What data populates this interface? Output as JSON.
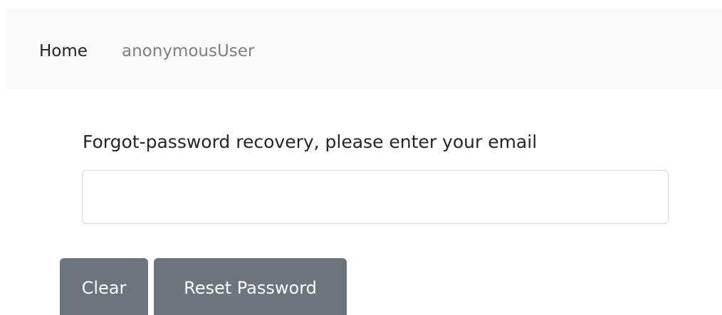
{
  "navbar": {
    "home_label": "Home",
    "user_label": "anonymousUser"
  },
  "form": {
    "label": "Forgot-password recovery, please enter your email",
    "email_value": "",
    "email_placeholder": ""
  },
  "buttons": {
    "clear_label": "Clear",
    "reset_label": "Reset Password"
  },
  "colors": {
    "navbar_bg": "#f8f9fa",
    "button_bg": "#6c757d",
    "button_text": "#ffffff",
    "nav_muted": "#7b8087"
  }
}
